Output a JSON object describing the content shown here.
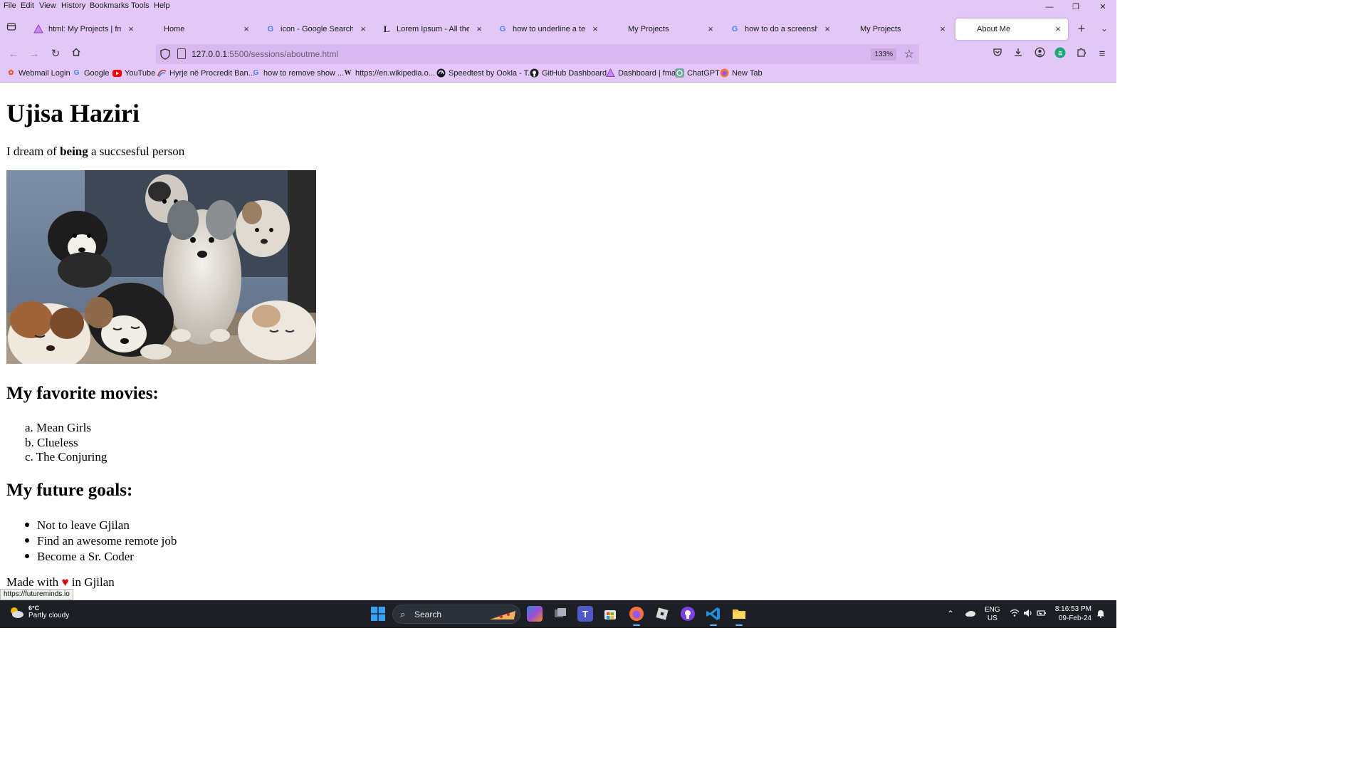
{
  "window": {
    "menu": [
      "File",
      "Edit",
      "View",
      "History",
      "Bookmarks",
      "Tools",
      "Help"
    ],
    "controls": {
      "minimize": "—",
      "restore": "❐",
      "close": "✕"
    }
  },
  "tabs": [
    {
      "title": "html: My Projects | fma",
      "icon": "fma-icon",
      "active": false
    },
    {
      "title": "Home",
      "icon": "none",
      "active": false
    },
    {
      "title": "icon - Google Search",
      "icon": "google-icon",
      "active": false
    },
    {
      "title": "Lorem Ipsum - All the facts",
      "icon": "lipsum-icon",
      "active": false
    },
    {
      "title": "how to underline a text html",
      "icon": "google-icon",
      "active": false
    },
    {
      "title": "My Projects",
      "icon": "none",
      "active": false
    },
    {
      "title": "how to do a screenshot on",
      "icon": "google-icon",
      "active": false
    },
    {
      "title": "My Projects",
      "icon": "none",
      "active": false
    },
    {
      "title": "About Me",
      "icon": "none",
      "active": true
    }
  ],
  "navbar": {
    "url_host": "127.0.0.1",
    "url_path": ":5500/sessions/aboutme.html",
    "zoom": "133%"
  },
  "bookmarks": [
    {
      "label": "Webmail Login",
      "icon": "webmail-icon",
      "color": "#e8572a"
    },
    {
      "label": "Google",
      "icon": "google-icon",
      "color": "#4285f4"
    },
    {
      "label": "YouTube",
      "icon": "youtube-icon",
      "color": "#ff0000"
    },
    {
      "label": "Hyrje në Procredit Ban...",
      "icon": "procredit-icon",
      "color": "#7a7a7a"
    },
    {
      "label": "how to remove show ...",
      "icon": "google-icon",
      "color": "#4285f4"
    },
    {
      "label": "https://en.wikipedia.o...",
      "icon": "wikipedia-icon",
      "color": "#222222"
    },
    {
      "label": "Speedtest by Ookla - T...",
      "icon": "speedtest-icon",
      "color": "#141526"
    },
    {
      "label": "GitHub Dashboard",
      "icon": "github-icon",
      "color": "#1b1b1b"
    },
    {
      "label": "Dashboard | fma",
      "icon": "fma-icon",
      "color": "#a855f7"
    },
    {
      "label": "ChatGPT",
      "icon": "chatgpt-icon",
      "color": "#74aa9c"
    },
    {
      "label": "New Tab",
      "icon": "firefox-icon",
      "color": "#ff7139"
    }
  ],
  "page": {
    "title": "Ujisa Haziri",
    "intro_before": "I dream of ",
    "intro_bold": "being",
    "intro_after": " a succsesful person",
    "movies_heading": "My favorite movies:",
    "movies": [
      {
        "marker": "a.",
        "text": "Mean Girls"
      },
      {
        "marker": "b.",
        "text": "Clueless"
      },
      {
        "marker": "c.",
        "text": "The Conjuring"
      }
    ],
    "goals_heading": "My future goals:",
    "goals": [
      "Not to leave Gjilan",
      "Find an awesome remote job",
      "Become a Sr. Coder"
    ],
    "footer_before": "Made with ",
    "footer_heart": "♥",
    "footer_after": " in Gjilan",
    "image_alt": "puppies"
  },
  "status_url": "https://futureminds.io",
  "taskbar": {
    "weather_temp": "6°C",
    "weather_desc": "Partly cloudy",
    "search_label": "Search",
    "lang_top": "ENG",
    "lang_bottom": "US",
    "time": "8:16:53 PM",
    "date": "09-Feb-24"
  },
  "colors": {
    "chrome_bg": "#e3c7f6",
    "urlbar_bg": "#d9b9ef",
    "taskbar_bg": "#1c1f24",
    "heart": "#e00000"
  }
}
